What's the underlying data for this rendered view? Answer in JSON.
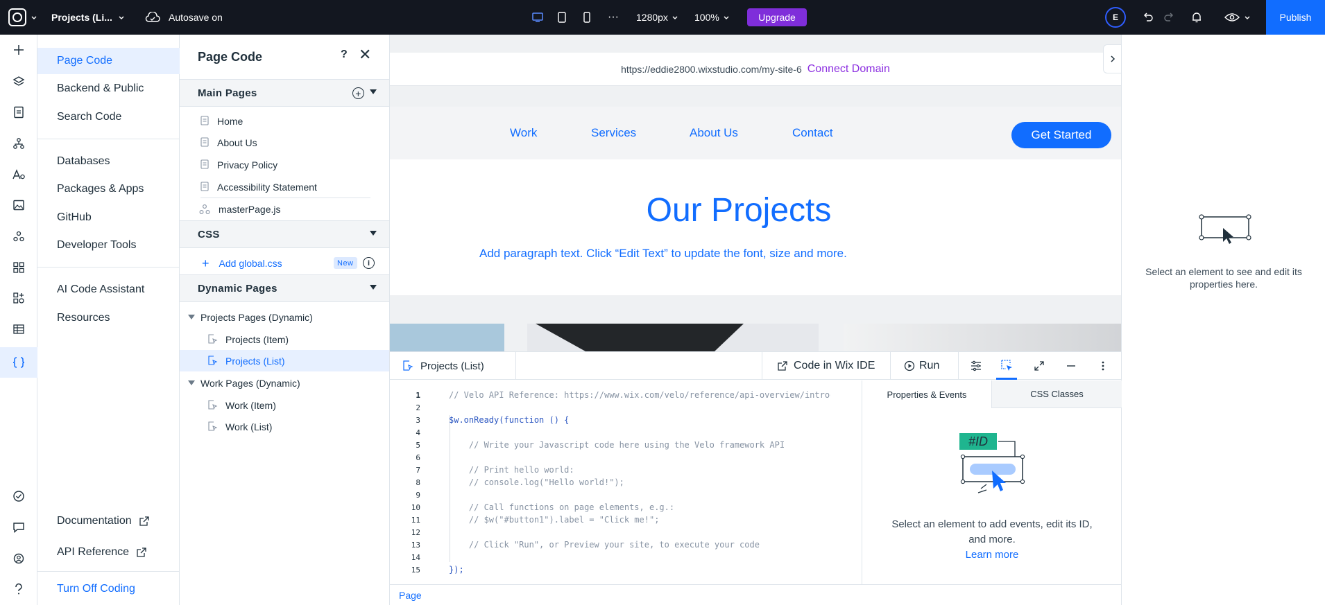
{
  "topbar": {
    "site_name": "Projects (Li...",
    "autosave": "Autosave on",
    "width_value": "1280px",
    "zoom_value": "100%",
    "upgrade_label": "Upgrade",
    "avatar_initial": "E",
    "publish_label": "Publish",
    "more_dots": "···"
  },
  "menu": {
    "items": [
      {
        "label": "Page Code"
      },
      {
        "label": "Backend & Public"
      },
      {
        "label": "Search Code"
      },
      {
        "label": "Databases"
      },
      {
        "label": "Packages & Apps"
      },
      {
        "label": "GitHub"
      },
      {
        "label": "Developer Tools"
      },
      {
        "label": "AI Code Assistant"
      },
      {
        "label": "Resources"
      },
      {
        "label": "Documentation"
      },
      {
        "label": "API Reference"
      },
      {
        "label": "Turn Off Coding"
      }
    ]
  },
  "page_code": {
    "title": "Page Code",
    "help": "?",
    "close": "✕",
    "main_pages_header": "Main Pages",
    "main_pages": [
      "Home",
      "About Us",
      "Privacy Policy",
      "Accessibility Statement"
    ],
    "master_page": "masterPage.js",
    "css_header": "CSS",
    "add_css": "Add global.css",
    "new_badge": "New",
    "info": "i",
    "dynamic_header": "Dynamic Pages",
    "dynamic_groups": [
      {
        "label": "Projects Pages (Dynamic)",
        "items": [
          "Projects (Item)",
          "Projects (List)"
        ]
      },
      {
        "label": "Work Pages (Dynamic)",
        "items": [
          "Work (Item)",
          "Work (List)"
        ]
      }
    ]
  },
  "canvas": {
    "url": "https://eddie2800.wixstudio.com/my-site-6",
    "connect_domain": "Connect Domain",
    "nav": [
      "Work",
      "Services",
      "About Us",
      "Contact"
    ],
    "cta": "Get Started",
    "heading": "Our Projects",
    "paragraph": "Add paragraph text. Click “Edit Text” to update the font, size and more."
  },
  "inspector": {
    "message": "Select an element to see and edit its properties here."
  },
  "code_panel": {
    "file_tab": "Projects (List)",
    "code_in_ide": "Code in Wix IDE",
    "run": "Run",
    "line_numbers": [
      "1",
      "2",
      "3",
      "4",
      "5",
      "6",
      "7",
      "8",
      "9",
      "10",
      "11",
      "12",
      "13",
      "14",
      "15"
    ],
    "lines": [
      "// Velo API Reference: https://www.wix.com/velo/reference/api-overview/introduc",
      "",
      "$w.onReady(function () {",
      "",
      "    // Write your Javascript code here using the Velo framework API",
      "",
      "    // Print hello world:",
      "    // console.log(\"Hello world!\");",
      "",
      "    // Call functions on page elements, e.g.:",
      "    // $w(\"#button1\").label = \"Click me!\";",
      "",
      "    // Click \"Run\", or Preview your site, to execute your code",
      "",
      "});"
    ],
    "props_tab": "Properties & Events",
    "css_tab": "CSS Classes",
    "id_tag": "#ID",
    "props_message": "Select an element to add events, edit its ID, and more.",
    "learn_more": "Learn more",
    "status": "Page"
  },
  "colors": {
    "accent": "#116dff",
    "upgrade": "#7f2eda",
    "topbar": "#131720",
    "selected_bg": "#e7f0ff",
    "id_tag": "#1fb58f"
  }
}
